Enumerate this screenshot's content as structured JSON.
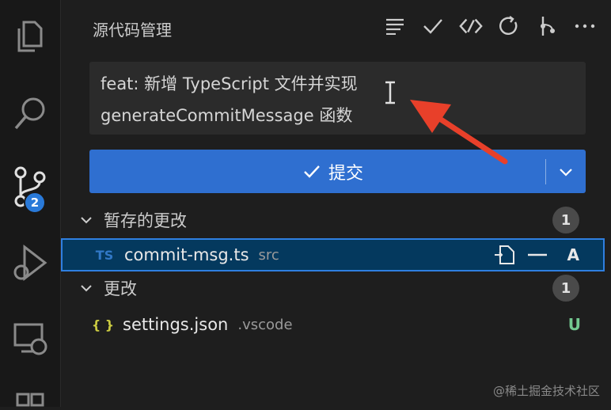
{
  "panel": {
    "title": "源代码管理",
    "commit_message_lines": [
      "feat: 新增 TypeScript 文件并实现",
      "generateCommitMessage 函数"
    ],
    "commit_button_label": "提交"
  },
  "activity": {
    "badge": "2"
  },
  "staged": {
    "label": "暂存的更改",
    "count": "1",
    "files": [
      {
        "icon": "TS",
        "name": "commit-msg.ts",
        "path": "src",
        "status": "A"
      }
    ]
  },
  "changes": {
    "label": "更改",
    "count": "1",
    "files": [
      {
        "icon": "{ }",
        "name": "settings.json",
        "path": ".vscode",
        "status": "U"
      }
    ]
  },
  "watermark": "@稀土掘金技术社区",
  "colors": {
    "accent": "#2f6fd0",
    "ts_icon": "#3178c6",
    "json_icon": "#cbcb41",
    "added": "#e8e8e8",
    "untracked": "#73c991",
    "annotation_arrow": "#e8402a"
  }
}
